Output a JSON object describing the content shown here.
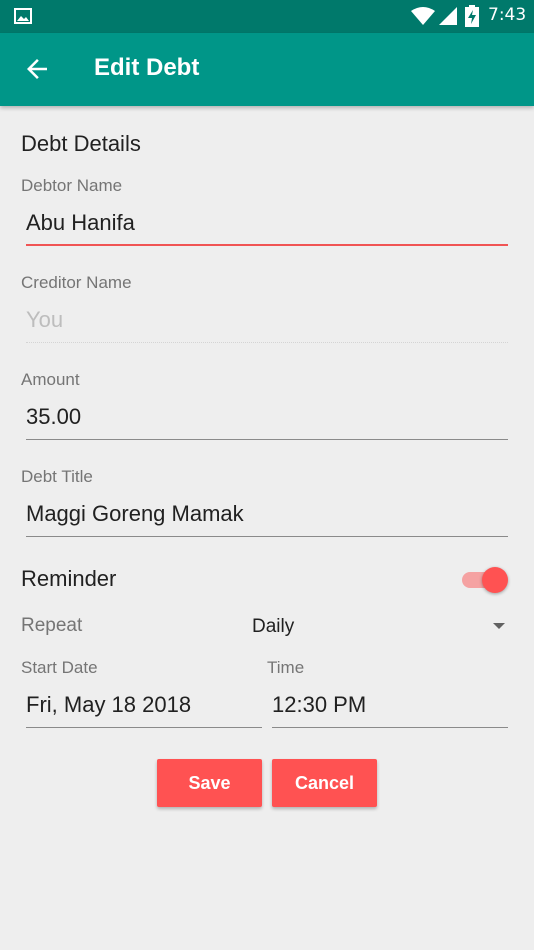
{
  "status_bar": {
    "time": "7:43",
    "icons": [
      "gallery-icon",
      "wifi-icon",
      "signal-icon",
      "battery-charging-icon"
    ]
  },
  "app_bar": {
    "title": "Edit Debt",
    "back_icon": "arrow-back-icon"
  },
  "form": {
    "section_title": "Debt Details",
    "debtor": {
      "label": "Debtor Name",
      "value": "Abu Hanifa"
    },
    "creditor": {
      "label": "Creditor Name",
      "value": "You"
    },
    "amount": {
      "label": "Amount",
      "value": "35.00"
    },
    "title": {
      "label": "Debt Title",
      "value": "Maggi Goreng Mamak"
    }
  },
  "reminder": {
    "title": "Reminder",
    "enabled": true,
    "repeat_label": "Repeat",
    "repeat_value": "Daily",
    "start_date_label": "Start Date",
    "start_date_value": "Fri, May 18 2018",
    "time_label": "Time",
    "time_value": "12:30 PM"
  },
  "buttons": {
    "save": "Save",
    "cancel": "Cancel"
  },
  "colors": {
    "status_bar": "#00796b",
    "app_bar": "#009688",
    "accent": "#ff5252",
    "background": "#eeeeee"
  }
}
